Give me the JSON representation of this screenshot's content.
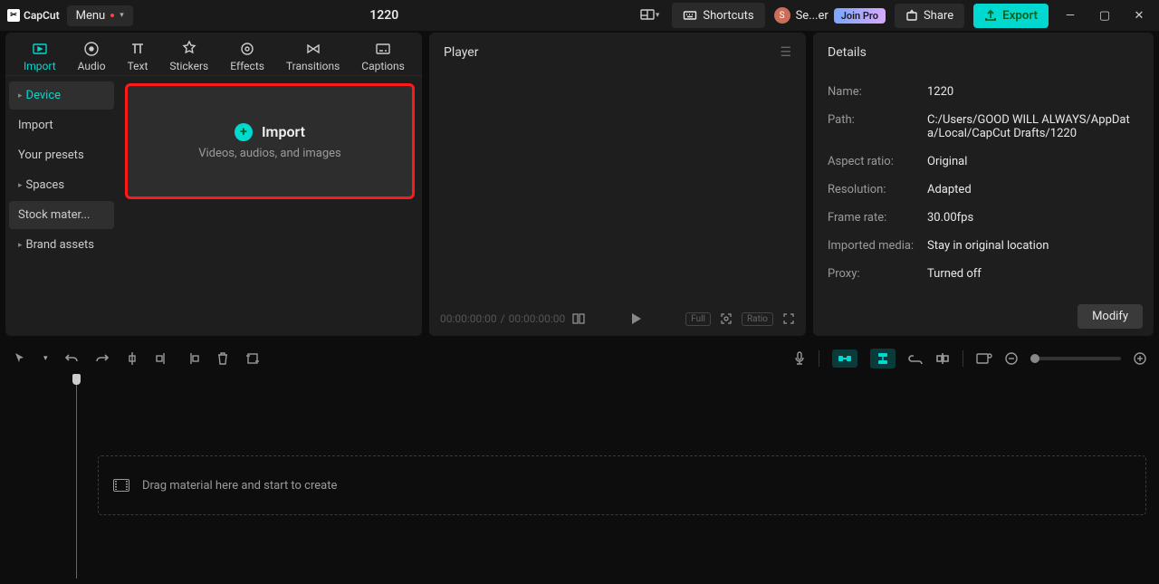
{
  "app": {
    "name": "CapCut",
    "menu_label": "Menu",
    "project_title": "1220"
  },
  "titlebar": {
    "shortcuts_label": "Shortcuts",
    "user_initial": "S",
    "user_label": "Se...er",
    "join_pro_label": "Join Pro",
    "share_label": "Share",
    "export_label": "Export"
  },
  "media_tabs": [
    {
      "id": "import",
      "label": "Import"
    },
    {
      "id": "audio",
      "label": "Audio"
    },
    {
      "id": "text",
      "label": "Text"
    },
    {
      "id": "stickers",
      "label": "Stickers"
    },
    {
      "id": "effects",
      "label": "Effects"
    },
    {
      "id": "transitions",
      "label": "Transitions"
    },
    {
      "id": "captions",
      "label": "Captions"
    }
  ],
  "sidebar": {
    "items": [
      {
        "label": "Device",
        "expandable": true,
        "active": true
      },
      {
        "label": "Import",
        "expandable": false
      },
      {
        "label": "Your presets",
        "expandable": false
      },
      {
        "label": "Spaces",
        "expandable": true
      },
      {
        "label": "Stock mater...",
        "expandable": false,
        "hov": true
      },
      {
        "label": "Brand assets",
        "expandable": true
      }
    ]
  },
  "import_box": {
    "title": "Import",
    "subtitle": "Videos, audios, and images"
  },
  "player": {
    "title": "Player",
    "time_current": "00:00:00:00",
    "time_sep": "/",
    "time_total": "00:00:00:00",
    "full_label": "Full",
    "ratio_label": "Ratio"
  },
  "details": {
    "title": "Details",
    "rows": [
      {
        "k": "Name:",
        "v": "1220"
      },
      {
        "k": "Path:",
        "v": "C:/Users/GOOD WILL ALWAYS/AppData/Local/CapCut Drafts/1220"
      },
      {
        "k": "Aspect ratio:",
        "v": "Original"
      },
      {
        "k": "Resolution:",
        "v": "Adapted"
      },
      {
        "k": "Frame rate:",
        "v": "30.00fps"
      },
      {
        "k": "Imported media:",
        "v": "Stay in original location"
      },
      {
        "k": "Proxy:",
        "v": "Turned off"
      }
    ],
    "modify_label": "Modify"
  },
  "timeline": {
    "drop_hint": "Drag material here and start to create"
  }
}
